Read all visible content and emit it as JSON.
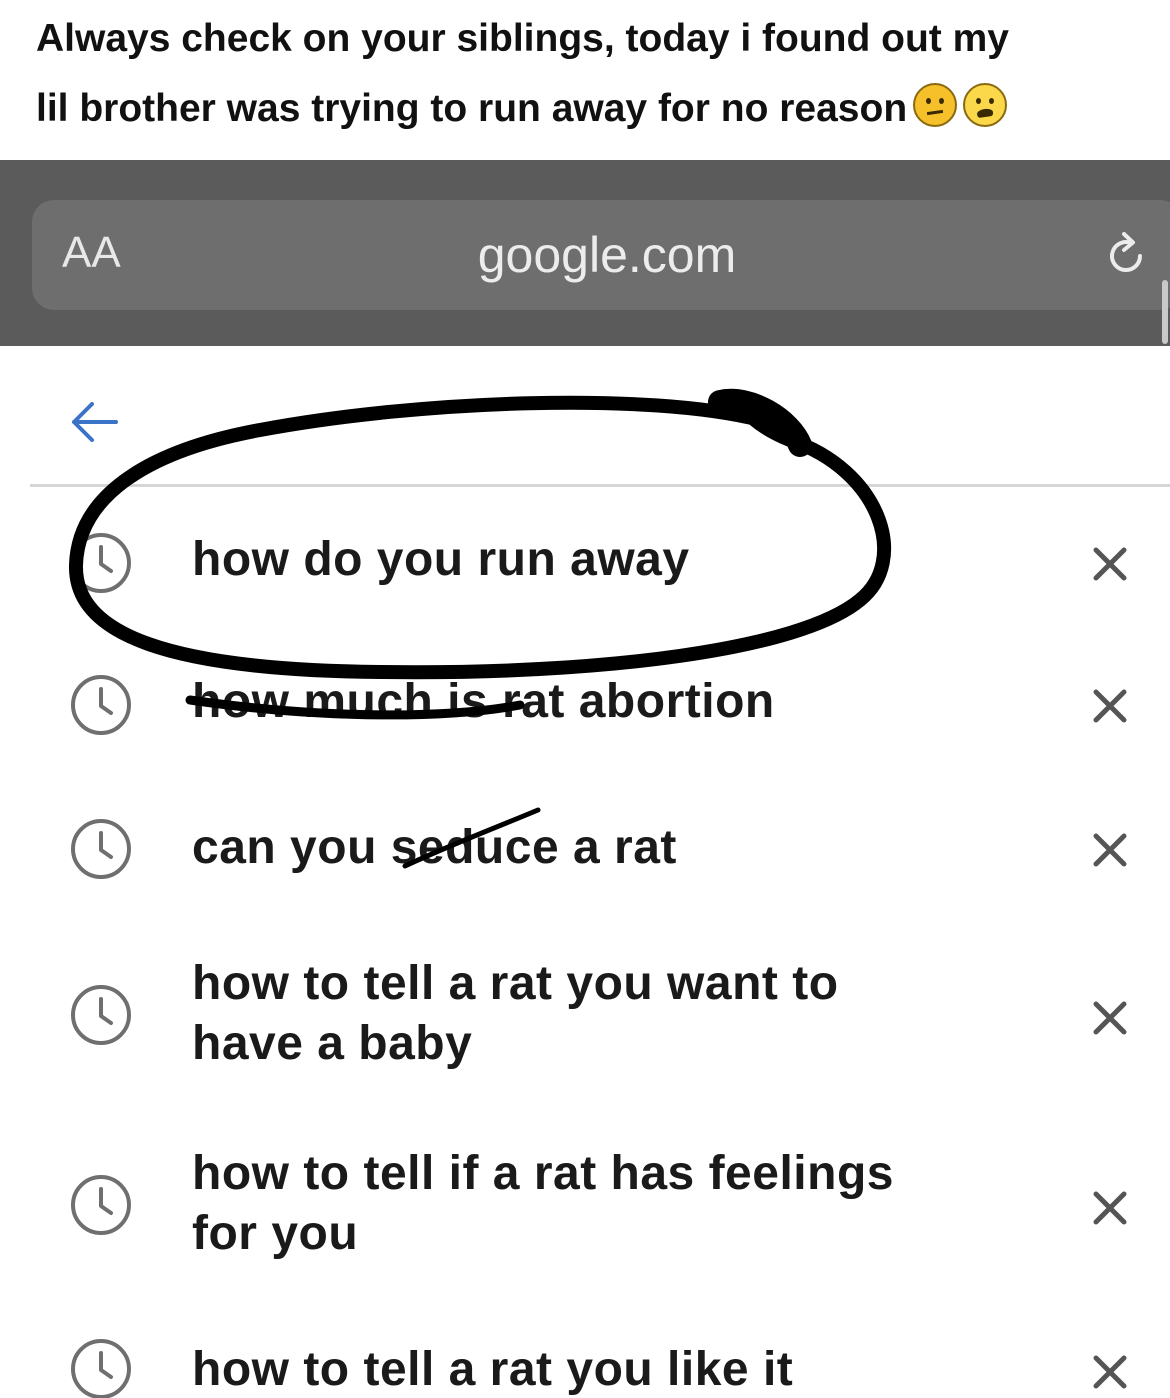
{
  "caption": {
    "line1": "Always check on your siblings, today i found out my",
    "line2": "lil brother was trying to run away for no reason",
    "emojis": [
      "confused-face-emoji",
      "crying-face-emoji"
    ]
  },
  "browser": {
    "text_size_button": "AA",
    "url": "google.com",
    "reload_icon": "reload-icon"
  },
  "search": {
    "back_icon": "back-arrow-icon",
    "suggestions": [
      {
        "line1": "how do you run away",
        "line2": ""
      },
      {
        "line1": "how much is rat abortion",
        "line2": ""
      },
      {
        "line1": "can you seduce a rat",
        "line2": ""
      },
      {
        "line1": "how to tell a rat you want to",
        "line2": "have a baby"
      },
      {
        "line1": "how to tell if a rat has feelings",
        "line2": "for you"
      },
      {
        "line1": "how to tell a rat you like it",
        "line2": ""
      }
    ],
    "history_icon": "clock-icon",
    "remove_icon": "close-icon"
  },
  "colors": {
    "toolbar": "#5b5b5b",
    "url_field": "#6e6e6e",
    "accent_blue": "#3b73c6",
    "icon_gray": "#6f6f6f",
    "annotation_ink": "#000000"
  }
}
